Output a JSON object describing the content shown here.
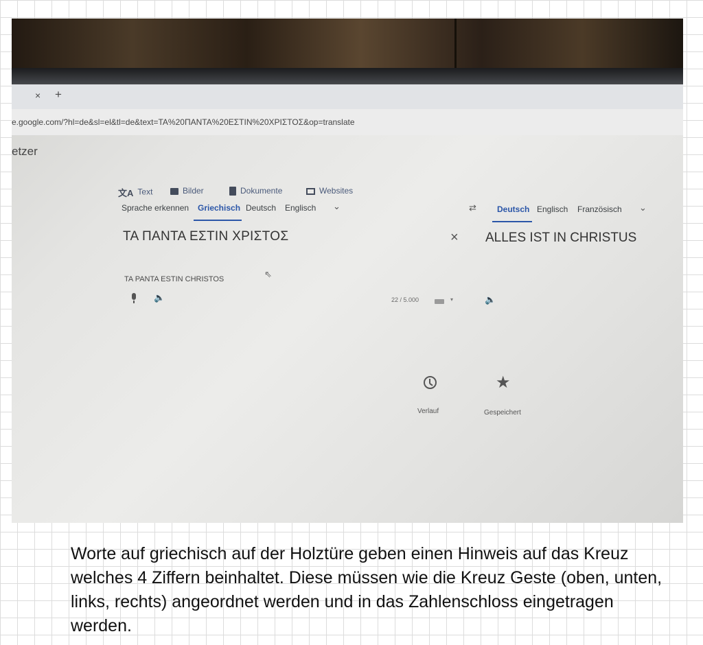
{
  "browser": {
    "tab_close": "×",
    "tab_new": "+",
    "url": "e.google.com/?hl=de&sl=el&tl=de&text=TA%20ΠANTA%20EΣTIN%20XPIΣTOΣ&op=translate",
    "site_title_fragment": "etzer"
  },
  "translate": {
    "tools": [
      {
        "label": "Text",
        "icon": "translate-icon"
      },
      {
        "label": "Bilder",
        "icon": "image-icon"
      },
      {
        "label": "Dokumente",
        "icon": "document-icon"
      },
      {
        "label": "Websites",
        "icon": "website-icon"
      }
    ],
    "source_languages": [
      "Sprache erkennen",
      "Griechisch",
      "Deutsch",
      "Englisch"
    ],
    "target_languages": [
      "Deutsch",
      "Englisch",
      "Französisch"
    ],
    "source_text": "ΤΑ ΠΑΝΤΑ ΕΣΤΙΝ ΧΡΙΣΤΟΣ",
    "transliteration": "TA PANTA ESTIN CHRISTOS",
    "char_count": "22 / 5.000",
    "translated_text": "ALLES IST IN CHRISTUS",
    "history_label": "Verlauf",
    "saved_label": "Gespeichert",
    "accent_color": "#2b56a8"
  },
  "caption": "Worte auf griechisch auf der Holztüre geben einen Hinweis auf das Kreuz welches 4 Ziffern beinhaltet. Diese müssen wie die Kreuz Geste (oben, unten, links, rechts) angeordnet werden und in das Zahlenschloss eingetragen werden."
}
